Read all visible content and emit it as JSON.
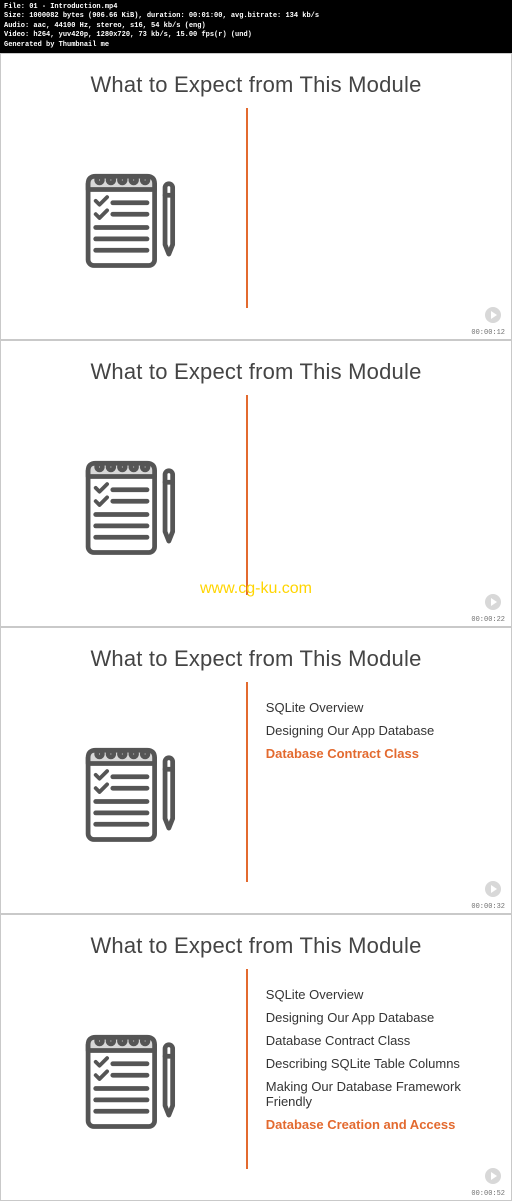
{
  "header": {
    "file_label": "File:",
    "file_value": "01 - Introduction.mp4",
    "size_label": "Size:",
    "size_value": "1000082 bytes (906.66 KiB), duration: 00:01:00, avg.bitrate: 134 kb/s",
    "audio_label": "Audio:",
    "audio_value": "aac, 44100 Hz, stereo, s16, 54 kb/s (eng)",
    "video_label": "Video:",
    "video_value": "h264, yuv420p, 1280x720, 73 kb/s, 15.00 fps(r) (und)",
    "generated": "Generated by Thumbnail me"
  },
  "slide_title": "What to Expect from This Module",
  "watermark": "www.cg-ku.com",
  "timestamps": [
    "00:00:12",
    "00:00:22",
    "00:00:32",
    "00:00:52"
  ],
  "slides": [
    {
      "topics": []
    },
    {
      "topics": []
    },
    {
      "topics": [
        {
          "label": "SQLite Overview",
          "active": false
        },
        {
          "label": "Designing Our App Database",
          "active": false
        },
        {
          "label": "Database Contract Class",
          "active": true
        }
      ]
    },
    {
      "topics": [
        {
          "label": "SQLite Overview",
          "active": false
        },
        {
          "label": "Designing Our App Database",
          "active": false
        },
        {
          "label": "Database Contract Class",
          "active": false
        },
        {
          "label": "Describing SQLite Table Columns",
          "active": false
        },
        {
          "label": "Making Our Database Framework Friendly",
          "active": false
        },
        {
          "label": "Database Creation and Access",
          "active": true
        }
      ]
    }
  ]
}
